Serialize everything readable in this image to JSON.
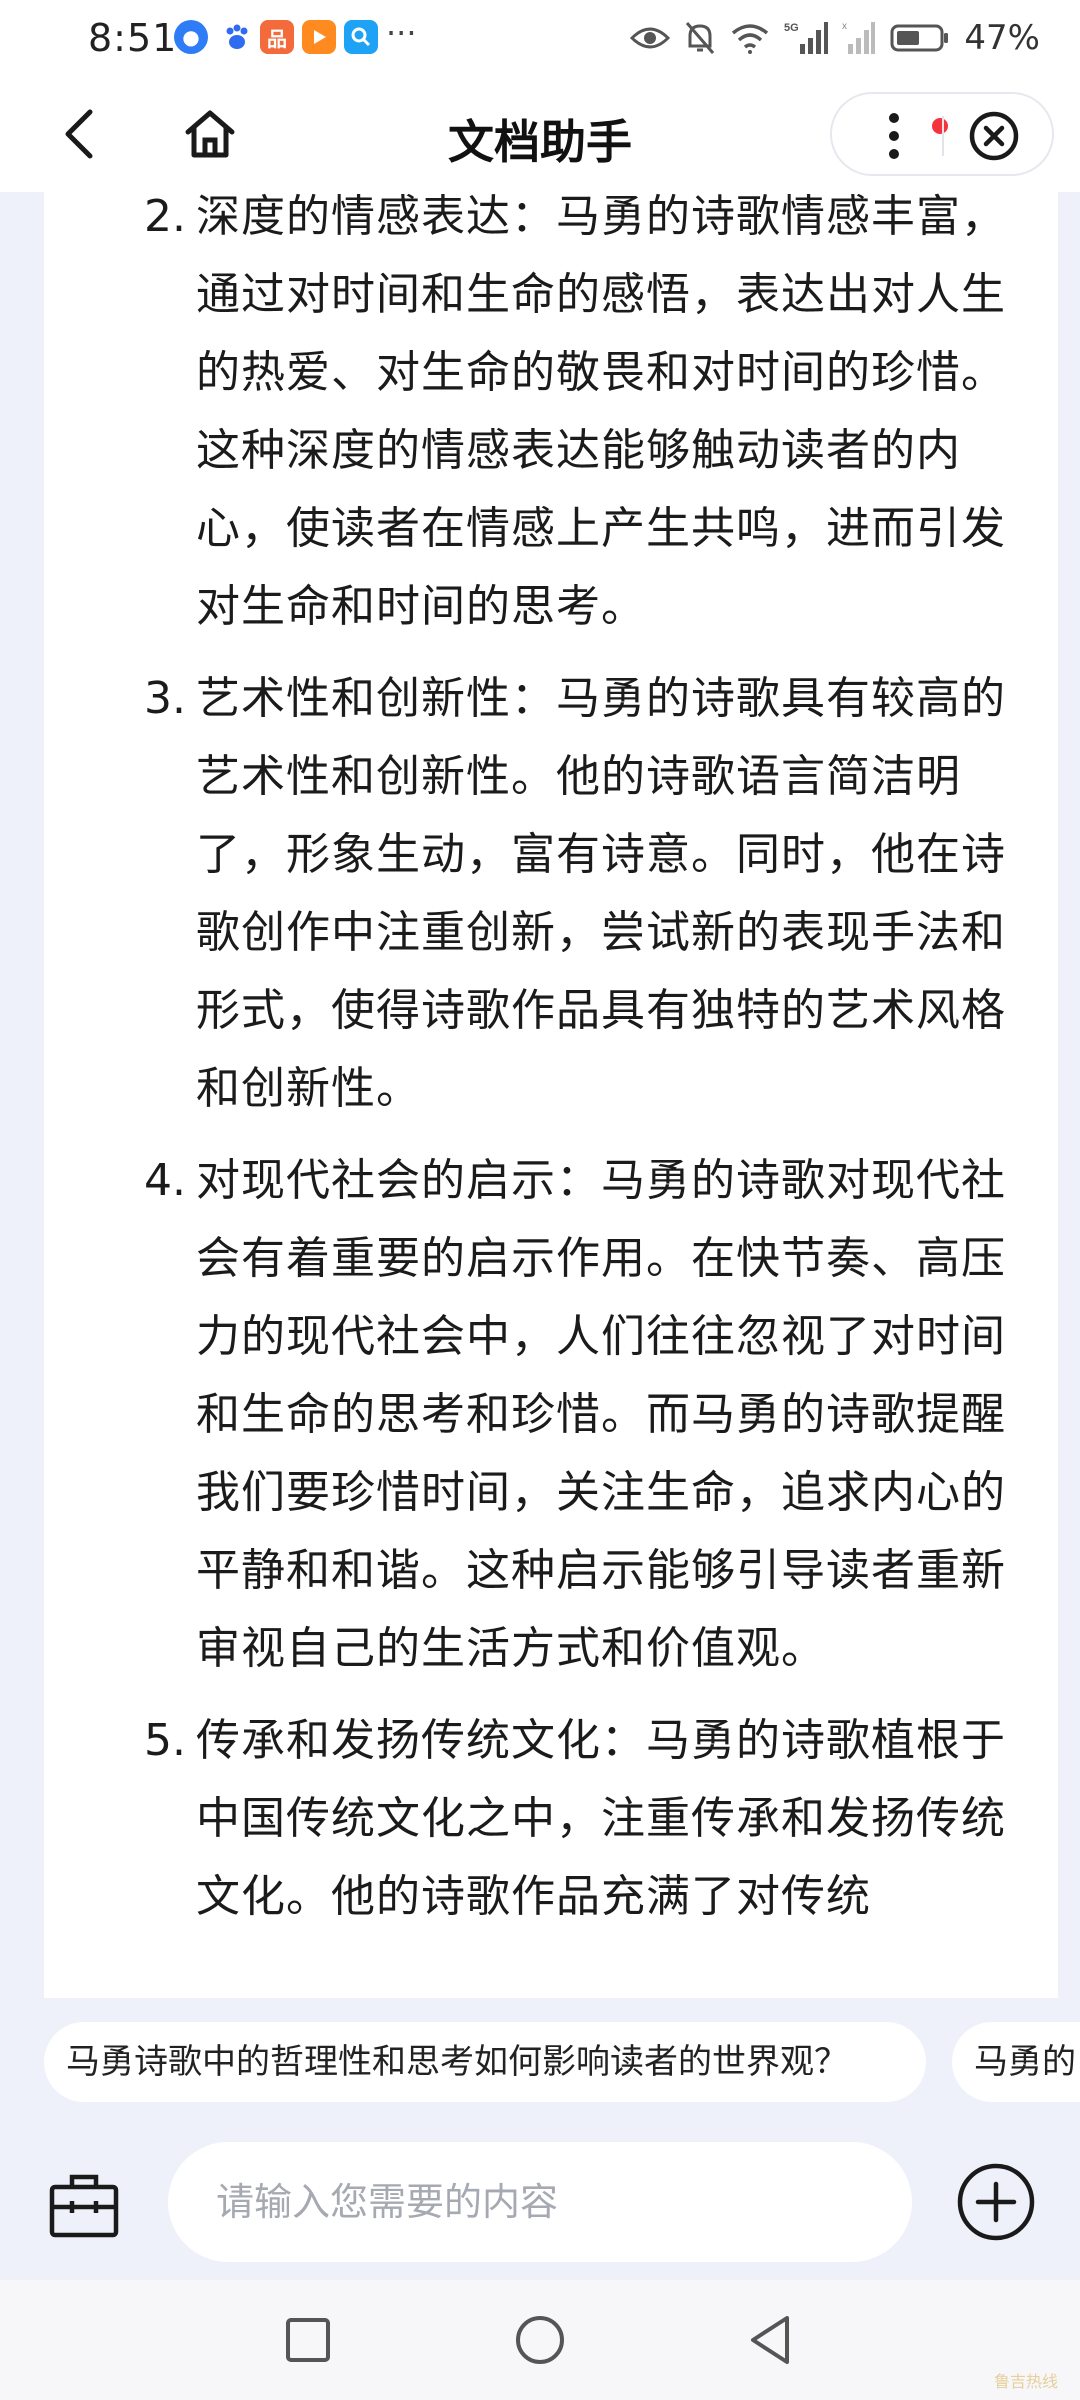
{
  "status_bar": {
    "time": "8:51",
    "battery": "47%",
    "network": "5G",
    "icons": [
      "qq-browser-icon",
      "baidu-icon",
      "app-icon",
      "video-app-icon",
      "search-app-icon",
      "eye-icon",
      "mute-icon",
      "wifi-icon",
      "signal-icon",
      "battery-icon"
    ],
    "notif_more": "···"
  },
  "header": {
    "title": "文档助手"
  },
  "answer": {
    "items": [
      {
        "num": "2.",
        "text": "深度的情感表达：马勇的诗歌情感丰富，通过对时间和生命的感悟，表达出对人生的热爱、对生命的敬畏和对时间的珍惜。这种深度的情感表达能够触动读者的内心，使读者在情感上产生共鸣，进而引发对生命和时间的思考。"
      },
      {
        "num": "3.",
        "text": "艺术性和创新性：马勇的诗歌具有较高的艺术性和创新性。他的诗歌语言简洁明了，形象生动，富有诗意。同时，他在诗歌创作中注重创新，尝试新的表现手法和形式，使得诗歌作品具有独特的艺术风格和创新性。"
      },
      {
        "num": "4.",
        "text": "对现代社会的启示：马勇的诗歌对现代社会有着重要的启示作用。在快节奏、高压力的现代社会中，人们往往忽视了对时间和生命的思考和珍惜。而马勇的诗歌提醒我们要珍惜时间，关注生命，追求内心的平静和和谐。这种启示能够引导读者重新审视自己的生活方式和价值观。"
      },
      {
        "num": "5.",
        "text": "传承和发扬传统文化：马勇的诗歌植根于中国传统文化之中，注重传承和发扬传统文化。他的诗歌作品充满了对传统"
      }
    ]
  },
  "suggestions": [
    "马勇诗歌中的哲理性和思考如何影响读者的世界观？",
    "马勇的"
  ],
  "input": {
    "placeholder": "请输入您需要的内容"
  },
  "watermark": "鲁吉热线",
  "colors": {
    "background": "#eef1f9",
    "card": "#ffffff",
    "text": "#1b1b1b",
    "badge_red": "#f4333c"
  }
}
